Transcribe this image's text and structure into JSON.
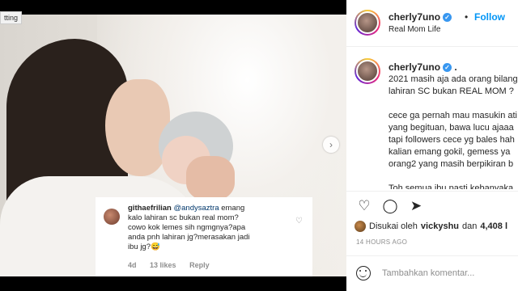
{
  "photo_pane": {
    "setting_label": "tting",
    "next_icon": "chevron-right-icon"
  },
  "comment_card": {
    "username": "githaefrilian",
    "mention": "@andysaztra",
    "text_1": " emang",
    "text_2": "kalo lahiran sc bukan real mom?",
    "text_3": "cowo kok lemes sih ngmgnya?apa",
    "text_4": "anda pnh lahiran jg?merasakan jadi",
    "text_5": "ibu jg?😅",
    "age": "4d",
    "likes": "13 likes",
    "reply": "Reply"
  },
  "header": {
    "username": "cherly7uno",
    "dot": "•",
    "follow_label": "Follow",
    "location": "Real Mom Life"
  },
  "caption": {
    "username": "cherly7uno",
    "suffix": ".",
    "lines": [
      "2021 masih aja ada orang bilang",
      "lahiran SC bukan REAL MOM ?",
      "",
      "cece ga pernah mau masukin ati",
      "yang begituan, bawa lucu ajaaa",
      "tapi followers cece yg bales hah",
      "kalian emang gokil, gemess ya",
      "orang2 yang masih berpikiran b",
      "",
      "Toh semua ibu pasti kebanyaka"
    ]
  },
  "actions": {
    "like_icon": "heart-icon",
    "comment_icon": "comment-icon",
    "share_icon": "send-icon",
    "liked_prefix": "Disukai oleh",
    "liked_user": "vickyshu",
    "liked_and": "dan",
    "liked_count": "4,408 l",
    "time_ago": "14 HOURS AGO"
  },
  "add_comment": {
    "placeholder": "Tambahkan komentar..."
  }
}
